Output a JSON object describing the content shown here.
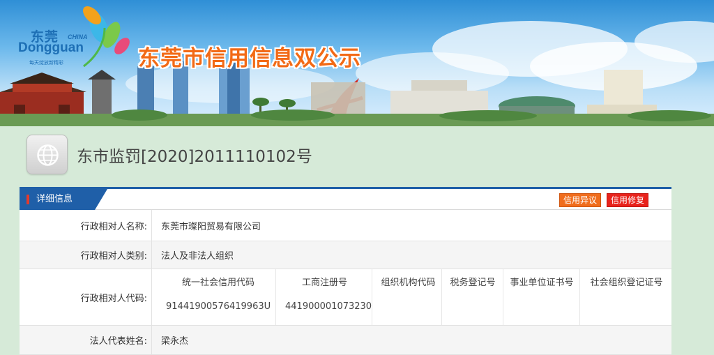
{
  "site": {
    "logo_cn": "东莞",
    "logo_en": "Dongguan",
    "logo_china": "CHINA",
    "logo_slogan": "每天绽放新精彩",
    "title": "东莞市信用信息双公示"
  },
  "document": {
    "title": "东市监罚[2020]2011110102号"
  },
  "panel": {
    "tab_label": "详细信息",
    "objection_button": "信用异议",
    "repair_button": "信用修复"
  },
  "fields": {
    "name_label": "行政相对人名称:",
    "name_value": "东莞市璨阳贸易有限公司",
    "category_label": "行政相对人类别:",
    "category_value": "法人及非法人组织",
    "code_label": "行政相对人代码:",
    "code_headers": [
      "统一社会信用代码",
      "工商注册号",
      "组织机构代码",
      "税务登记号",
      "事业单位证书号",
      "社会组织登记证号"
    ],
    "code_values": [
      "91441900576419963U",
      "441900001073230",
      "",
      "",
      "",
      ""
    ],
    "legal_rep_label": "法人代表姓名:",
    "legal_rep_value": "梁永杰"
  },
  "colors": {
    "accent_blue": "#1f5fa8",
    "title_orange": "#f26a16",
    "objection_orange": "#f06d1d",
    "repair_red": "#e8231c",
    "page_green": "#d6ead8"
  }
}
